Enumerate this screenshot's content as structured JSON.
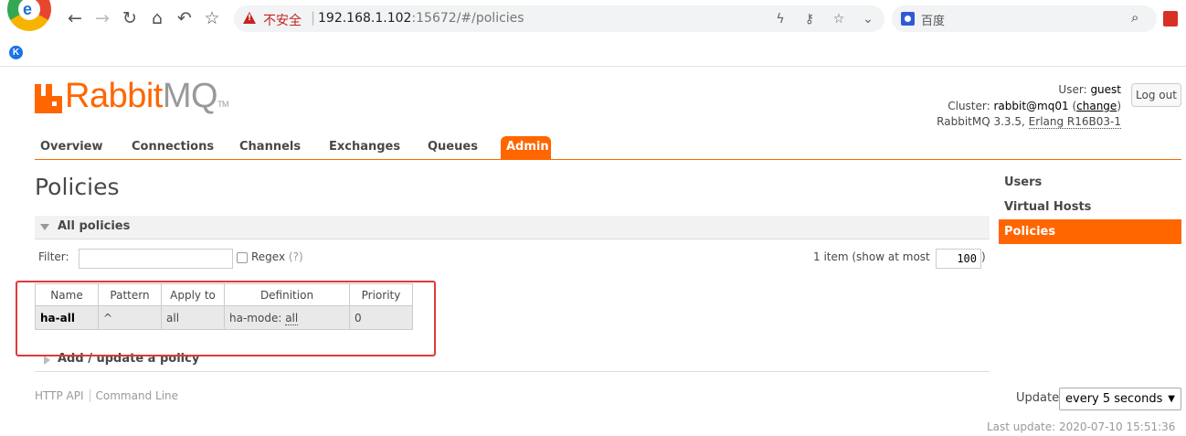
{
  "browser": {
    "insecure_label": "不安全",
    "url_host": "192.168.1.102",
    "url_rest": ":15672/#/policies",
    "search_engine": "百度"
  },
  "app": {
    "logo_rabbit": "Rabbit",
    "logo_mq": "MQ",
    "logo_tm": "TM",
    "brand_color": "#ff6600"
  },
  "login": {
    "user_label": "User:",
    "user": "guest",
    "cluster_label": "Cluster:",
    "cluster": "rabbit@mq01",
    "change": "change",
    "version": "RabbitMQ 3.3.5,",
    "erlang": "Erlang R16B03-1",
    "logout": "Log out"
  },
  "tabs": [
    {
      "label": "Overview"
    },
    {
      "label": "Connections"
    },
    {
      "label": "Channels"
    },
    {
      "label": "Exchanges"
    },
    {
      "label": "Queues"
    },
    {
      "label": "Admin"
    }
  ],
  "page": {
    "title": "Policies",
    "section_all": "All policies",
    "section_add": "Add / update a policy"
  },
  "filter": {
    "label": "Filter:",
    "value": "",
    "regex_label": "Regex",
    "regex_help": "(?)",
    "item_count": "1 item (show at most",
    "limit": "100",
    "limit_close": ")"
  },
  "table": {
    "headers": [
      "Name",
      "Pattern",
      "Apply to",
      "Definition",
      "Priority"
    ],
    "rows": [
      {
        "name": "ha-all",
        "pattern": "^",
        "apply_to": "all",
        "definition_key": "ha-mode:",
        "definition_value": "all",
        "priority": "0"
      }
    ]
  },
  "footer": {
    "http_api": "HTTP API",
    "command_line": "Command Line"
  },
  "side_menu": [
    {
      "label": "Users"
    },
    {
      "label": "Virtual Hosts"
    },
    {
      "label": "Policies"
    }
  ],
  "update": {
    "label": "Update",
    "selected": "every 5 seconds",
    "last_update": "Last update: 2020-07-10 15:51:36"
  }
}
